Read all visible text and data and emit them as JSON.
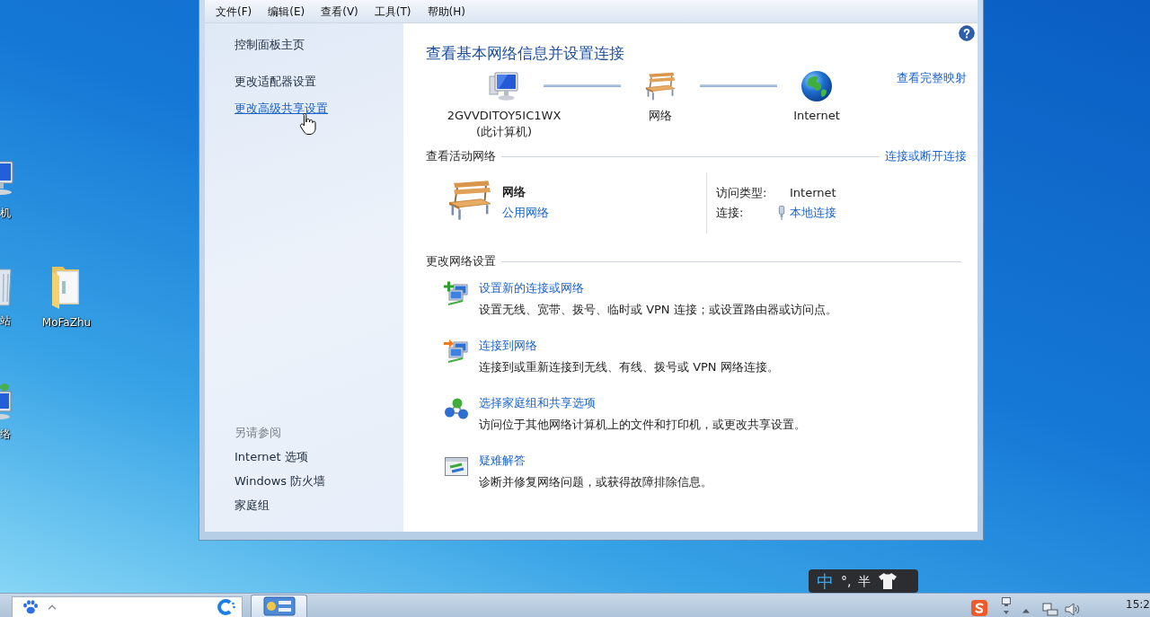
{
  "desktop": {
    "icons": [
      {
        "kind": "computer",
        "label": "机"
      },
      {
        "kind": "recycle_bin",
        "label": "站"
      },
      {
        "kind": "folder",
        "label": "MoFaZhu"
      },
      {
        "kind": "network",
        "label": "络"
      }
    ]
  },
  "window": {
    "menu": [
      "文件(F)",
      "编辑(E)",
      "查看(V)",
      "工具(T)",
      "帮助(H)"
    ],
    "sidebar": {
      "home": "控制面板主页",
      "tasks": [
        {
          "label": "更改适配器设置",
          "hovered": false
        },
        {
          "label": "更改高级共享设置",
          "hovered": true
        }
      ],
      "see_also_title": "另请参阅",
      "see_also": [
        "Internet 选项",
        "Windows 防火墙",
        "家庭组"
      ]
    },
    "main": {
      "title": "查看基本网络信息并设置连接",
      "map": {
        "nodes": [
          {
            "kind": "computer",
            "name": "2GVVDITOY5IC1WX",
            "note": "(此计算机)"
          },
          {
            "kind": "network",
            "name": "网络"
          },
          {
            "kind": "internet",
            "name": "Internet"
          }
        ],
        "full_map_link": "查看完整映射"
      },
      "active": {
        "heading": "查看活动网络",
        "link": "连接或断开连接",
        "network_name": "网络",
        "network_type": "公用网络",
        "details": [
          {
            "kind": "text",
            "label": "访问类型:",
            "value": "Internet"
          },
          {
            "kind": "link",
            "label": "连接:",
            "value": "本地连接"
          }
        ]
      },
      "settings": {
        "heading": "更改网络设置",
        "tasks": [
          {
            "kind": "new_connection",
            "title": "设置新的连接或网络",
            "description": "设置无线、宽带、拨号、临时或 VPN 连接；或设置路由器或访问点。"
          },
          {
            "kind": "connect",
            "title": "连接到网络",
            "description": "连接到或重新连接到无线、有线、拨号或 VPN 网络连接。"
          },
          {
            "kind": "homegroup",
            "title": "选择家庭组和共享选项",
            "description": "访问位于其他网络计算机上的文件和打印机，或更改共享设置。"
          },
          {
            "kind": "troubleshoot",
            "title": "疑难解答",
            "description": "诊断并修复网络问题，或获得故障排除信息。"
          }
        ]
      }
    }
  },
  "ime_bar": {
    "mode": "中",
    "punctuation": "°,",
    "width": "半"
  },
  "taskbar": {
    "apps": [
      {
        "kind": "control_panel",
        "active": true
      }
    ],
    "clock": "15:2"
  }
}
